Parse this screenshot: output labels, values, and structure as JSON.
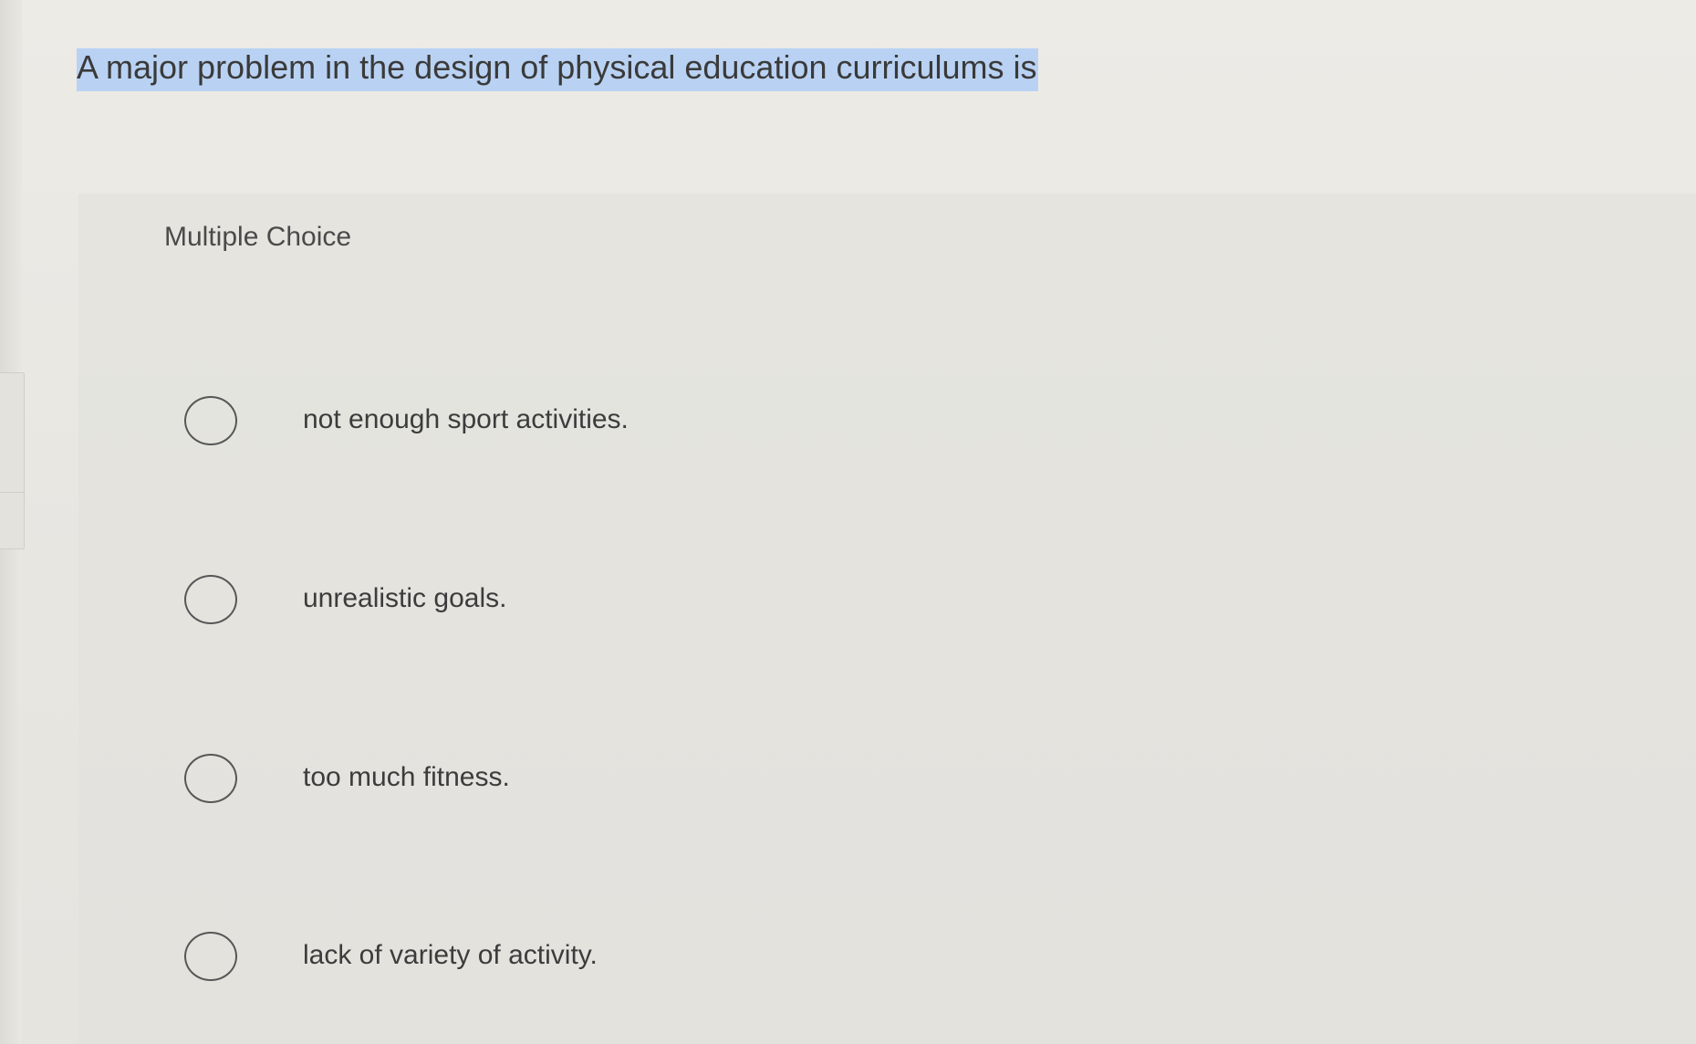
{
  "question": {
    "text": "A major problem in the design of physical education curriculums is"
  },
  "answer_panel": {
    "title": "Multiple Choice",
    "options": [
      {
        "label": "not enough sport activities.",
        "selected": false
      },
      {
        "label": "unrealistic goals.",
        "selected": false
      },
      {
        "label": "too much fitness.",
        "selected": false
      },
      {
        "label": "lack of variety of activity.",
        "selected": false
      }
    ]
  },
  "colors": {
    "background": "#eceae5",
    "panel": "#e4e3de",
    "selection_highlight": "#b9d2f3",
    "radio_border": "#575757",
    "text": "#3c3c3c"
  }
}
